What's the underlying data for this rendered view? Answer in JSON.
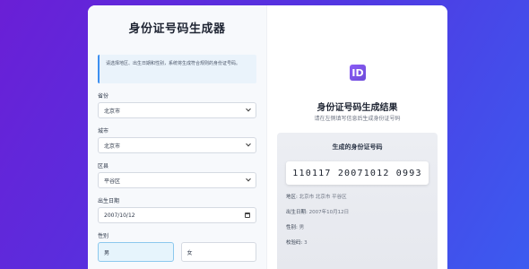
{
  "form": {
    "title": "身份证号码生成器",
    "info": "请选择地区、出生日期和性别，系统将生成符合规则的身份证号码。",
    "province_label": "省份",
    "province_value": "北京市",
    "city_label": "城市",
    "city_value": "北京市",
    "district_label": "区县",
    "district_value": "平谷区",
    "birth_label": "出生日期",
    "birth_value": "2007/10/12",
    "gender_label": "性别",
    "gender_male": "男",
    "gender_female": "女"
  },
  "result": {
    "logo_text": "ID",
    "title": "身份证号码生成结果",
    "subtitle": "请在左侧填写信息后生成身份证号码",
    "card_title": "生成的身份证号码",
    "id_number": "110117 20071012 0993",
    "region_label": "地区:",
    "region_value": "北京市 北京市 平谷区",
    "birth_label": "出生日期:",
    "birth_value": "2007年10月12日",
    "gender_label": "性别:",
    "gender_value": "男",
    "check_label": "校验码:",
    "check_value": "3"
  },
  "colors": {
    "bg_start": "#6a1fd6",
    "bg_end": "#3b5bf0",
    "accent": "#3d8ff0",
    "logo": "#7c55e6"
  },
  "icons": [
    "chevron-down-icon",
    "calendar-icon",
    "id-logo-icon"
  ]
}
